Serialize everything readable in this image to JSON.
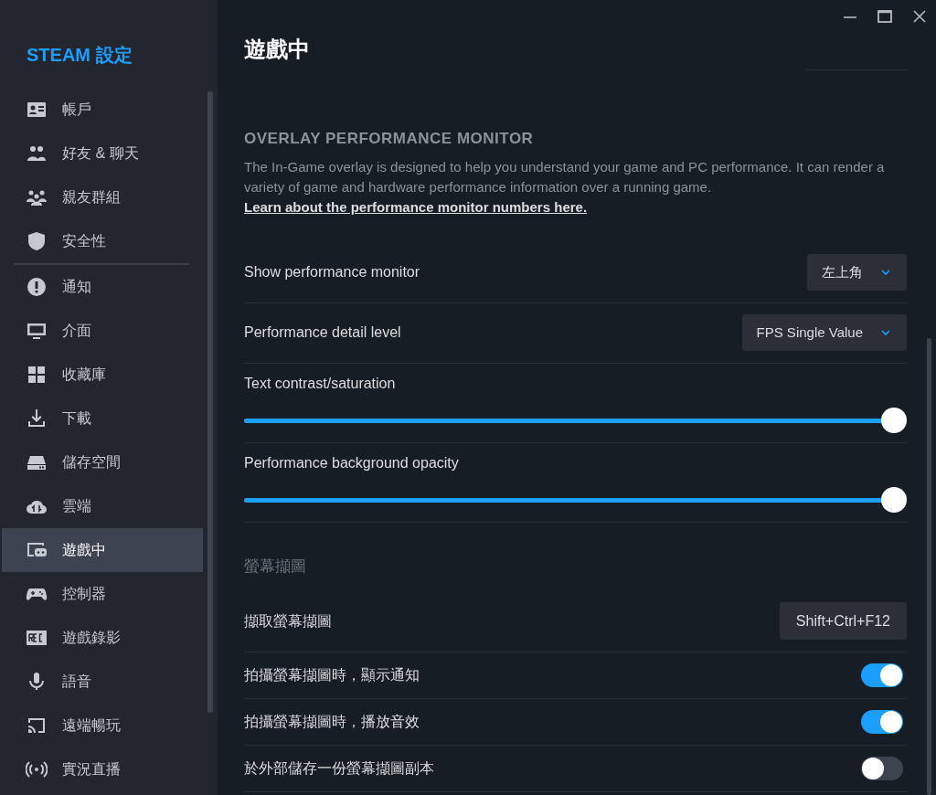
{
  "sidebar": {
    "title": "STEAM 設定",
    "items": [
      {
        "label": "帳戶",
        "selected": false
      },
      {
        "label": "好友 & 聊天",
        "selected": false
      },
      {
        "label": "親友群組",
        "selected": false
      },
      {
        "label": "安全性",
        "selected": false
      },
      {
        "label": "通知",
        "selected": false
      },
      {
        "label": "介面",
        "selected": false
      },
      {
        "label": "收藏庫",
        "selected": false
      },
      {
        "label": "下載",
        "selected": false
      },
      {
        "label": "儲存空間",
        "selected": false
      },
      {
        "label": "雲端",
        "selected": false
      },
      {
        "label": "遊戲中",
        "selected": true
      },
      {
        "label": "控制器",
        "selected": false
      },
      {
        "label": "遊戲錄影",
        "selected": false
      },
      {
        "label": "語音",
        "selected": false
      },
      {
        "label": "遠端暢玩",
        "selected": false
      },
      {
        "label": "實況直播",
        "selected": false
      }
    ]
  },
  "page": {
    "title": "遊戲中",
    "section_heading": "OVERLAY PERFORMANCE MONITOR",
    "description": "The In-Game overlay is designed to help you understand your game and PC performance. It can render a variety of game and hardware performance information over a running game.",
    "description_link": "Learn about the performance monitor numbers here.",
    "settings": [
      {
        "kind": "dropdown",
        "label": "Show performance monitor",
        "value": "左上角"
      },
      {
        "kind": "dropdown",
        "label": "Performance detail level",
        "value": "FPS Single Value"
      },
      {
        "kind": "slider",
        "label": "Text contrast/saturation",
        "level": 1
      },
      {
        "kind": "slider",
        "label": "Performance background opacity",
        "level": 1
      },
      {
        "kind": "heading",
        "label": "螢幕擷圖"
      },
      {
        "kind": "hotkey",
        "label": "擷取螢幕擷圖",
        "value": "Shift+Ctrl+F12"
      },
      {
        "kind": "toggle",
        "label": "拍攝螢幕擷圖時，顯示通知",
        "on": true
      },
      {
        "kind": "toggle",
        "label": "拍攝螢幕擷圖時，播放音效",
        "on": true
      },
      {
        "kind": "toggle",
        "label": "於外部儲存一份螢幕擷圖副本",
        "on": false
      }
    ]
  }
}
